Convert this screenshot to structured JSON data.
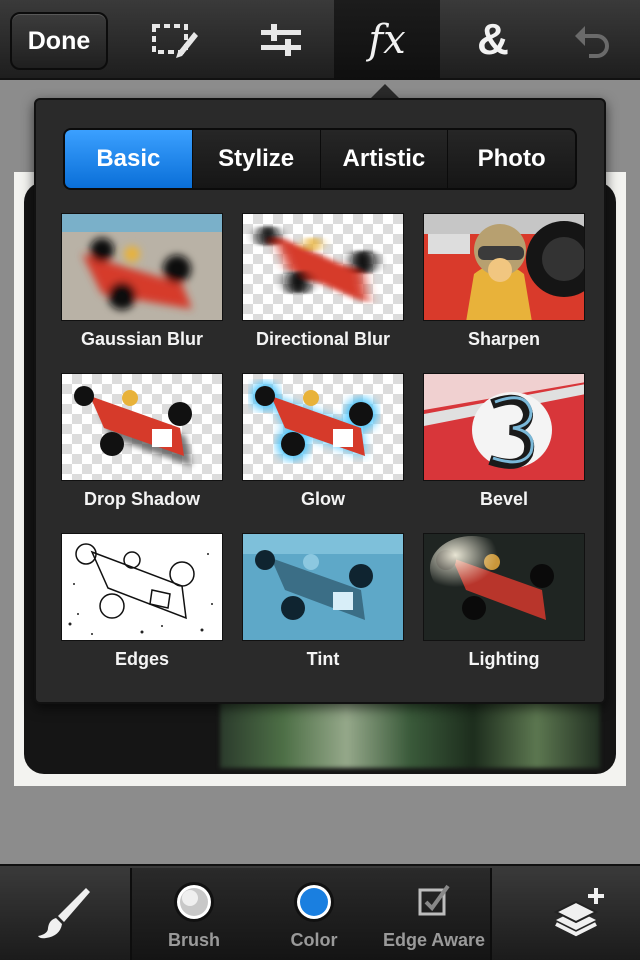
{
  "toolbar": {
    "done_label": "Done",
    "tools": [
      {
        "name": "selection-tool",
        "icon": "dashed-select-pencil-icon"
      },
      {
        "name": "adjustments-tool",
        "icon": "sliders-icon"
      },
      {
        "name": "effects-tool",
        "label": "fx",
        "active": true
      },
      {
        "name": "overlay-tool",
        "label": "&"
      },
      {
        "name": "undo",
        "icon": "undo-arrow-icon"
      }
    ]
  },
  "effects_panel": {
    "tabs": [
      {
        "label": "Basic",
        "selected": true
      },
      {
        "label": "Stylize",
        "selected": false
      },
      {
        "label": "Artistic",
        "selected": false
      },
      {
        "label": "Photo",
        "selected": false
      }
    ],
    "effects": [
      {
        "label": "Gaussian Blur"
      },
      {
        "label": "Directional Blur"
      },
      {
        "label": "Sharpen"
      },
      {
        "label": "Drop Shadow"
      },
      {
        "label": "Glow"
      },
      {
        "label": "Bevel"
      },
      {
        "label": "Edges"
      },
      {
        "label": "Tint"
      },
      {
        "label": "Lighting"
      }
    ]
  },
  "bottom_bar": {
    "brush_label": "Brush",
    "color_label": "Color",
    "edge_aware_label": "Edge Aware",
    "colors": {
      "brush_swatch": "#c8c8c8",
      "color_swatch": "#1a7fe0",
      "accent": "#1b86f0"
    }
  }
}
